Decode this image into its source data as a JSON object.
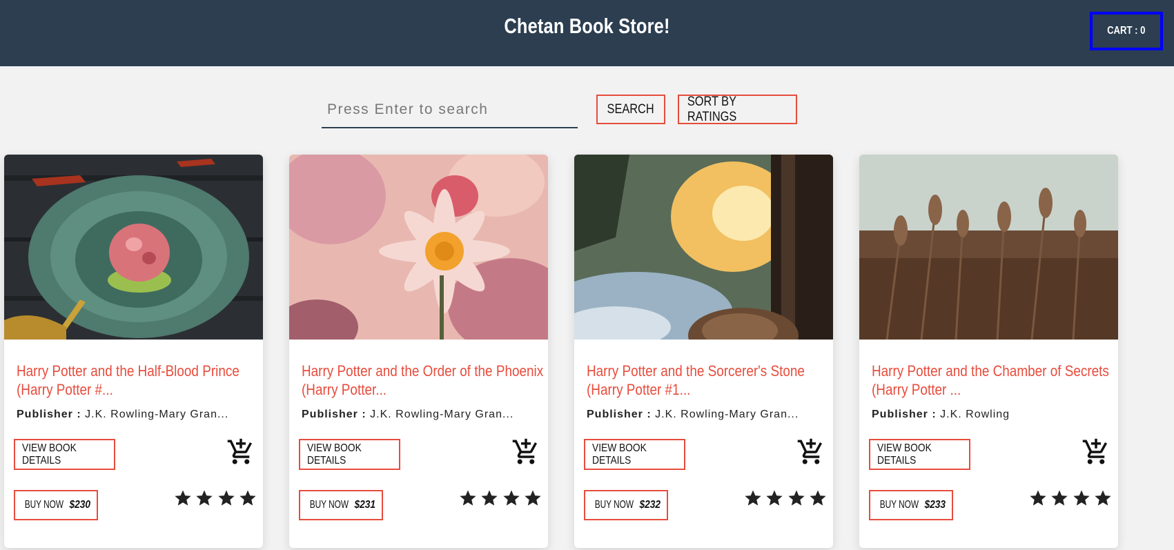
{
  "header": {
    "title": "Chetan Book Store!",
    "cart_label": "CART : 0"
  },
  "search": {
    "placeholder": "Press Enter to search",
    "value": "",
    "search_label": "SEARCH",
    "sort_label": "SORT BY RATINGS"
  },
  "books": [
    {
      "title": "Harry Potter and the Half-Blood Prince (Harry Potter #...",
      "publisher_label": "Publisher :",
      "publisher": "J.K. Rowling-Mary Gran...",
      "view_label": "VIEW BOOK DETAILS",
      "buy_label": "BUY NOW",
      "price": "$230",
      "rating": 4
    },
    {
      "title": "Harry Potter and the Order of the Phoenix (Harry Potter...",
      "publisher_label": "Publisher :",
      "publisher": "J.K. Rowling-Mary Gran...",
      "view_label": "VIEW BOOK DETAILS",
      "buy_label": "BUY NOW",
      "price": "$231",
      "rating": 4
    },
    {
      "title": "Harry Potter and the Sorcerer's Stone (Harry Potter #1...",
      "publisher_label": "Publisher :",
      "publisher": "J.K. Rowling-Mary Gran...",
      "view_label": "VIEW BOOK DETAILS",
      "buy_label": "BUY NOW",
      "price": "$232",
      "rating": 4
    },
    {
      "title": "Harry Potter and the Chamber of Secrets (Harry Potter ...",
      "publisher_label": "Publisher :",
      "publisher": "J.K. Rowling",
      "view_label": "VIEW BOOK DETAILS",
      "buy_label": "BUY NOW",
      "price": "$233",
      "rating": 4
    }
  ],
  "colors": {
    "header_bg": "#2c3e50",
    "accent": "#e74c3c",
    "cart_border": "#0000ff"
  }
}
